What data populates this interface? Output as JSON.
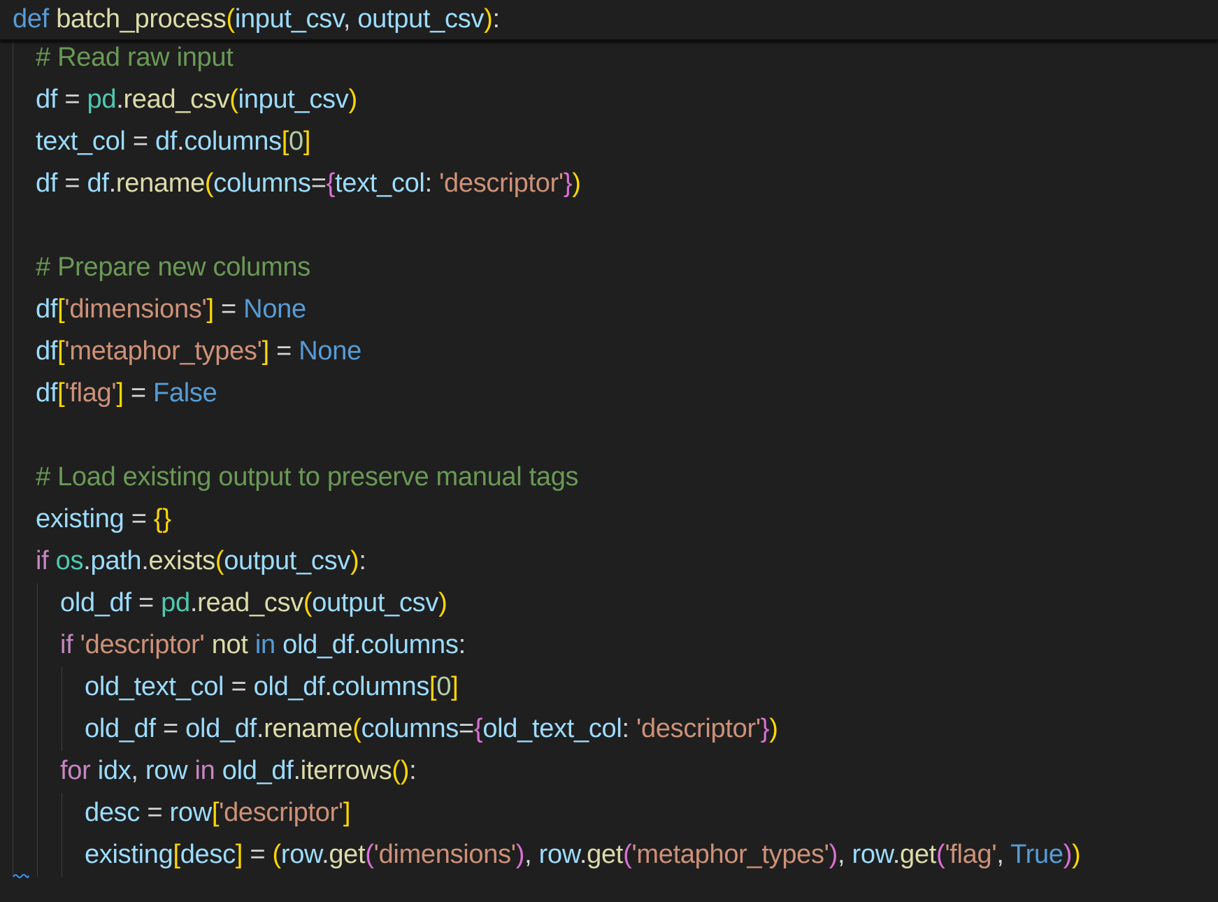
{
  "colors": {
    "background": "#1f1f1f",
    "keyword": "#569cd6",
    "control": "#c586c0",
    "function": "#dcdcaa",
    "variable": "#9cdcfe",
    "plain": "#d4d4d4",
    "string": "#ce9178",
    "comment": "#6a9955",
    "module": "#4ec9b0",
    "number": "#b5cea8",
    "bracket1": "#ffd700",
    "bracket2": "#da70d6",
    "bracket3": "#179fff",
    "squiggle": "#3794ff"
  },
  "editor": {
    "sticky_line": [
      [
        "def",
        "keyword"
      ],
      [
        " ",
        "plain"
      ],
      [
        "batch_process",
        "function"
      ],
      [
        "(",
        "bracket1"
      ],
      [
        "input_csv",
        "variable"
      ],
      [
        ", ",
        "plain"
      ],
      [
        "output_csv",
        "variable"
      ],
      [
        ")",
        "bracket1"
      ],
      [
        ":",
        "plain"
      ]
    ],
    "lines": [
      {
        "indent": 1,
        "tokens": [
          [
            "# Read raw input",
            "comment"
          ]
        ]
      },
      {
        "indent": 1,
        "tokens": [
          [
            "df",
            "variable"
          ],
          [
            " = ",
            "plain"
          ],
          [
            "pd",
            "module"
          ],
          [
            ".",
            "plain"
          ],
          [
            "read_csv",
            "function"
          ],
          [
            "(",
            "bracket1"
          ],
          [
            "input_csv",
            "variable"
          ],
          [
            ")",
            "bracket1"
          ]
        ]
      },
      {
        "indent": 1,
        "tokens": [
          [
            "text_col",
            "variable"
          ],
          [
            " = ",
            "plain"
          ],
          [
            "df",
            "variable"
          ],
          [
            ".",
            "plain"
          ],
          [
            "columns",
            "variable"
          ],
          [
            "[",
            "bracket1"
          ],
          [
            "0",
            "number"
          ],
          [
            "]",
            "bracket1"
          ]
        ]
      },
      {
        "indent": 1,
        "tokens": [
          [
            "df",
            "variable"
          ],
          [
            " = ",
            "plain"
          ],
          [
            "df",
            "variable"
          ],
          [
            ".",
            "plain"
          ],
          [
            "rename",
            "function"
          ],
          [
            "(",
            "bracket1"
          ],
          [
            "columns",
            "variable"
          ],
          [
            "=",
            "plain"
          ],
          [
            "{",
            "bracket2"
          ],
          [
            "text_col",
            "variable"
          ],
          [
            ": ",
            "plain"
          ],
          [
            "'descriptor'",
            "string"
          ],
          [
            "}",
            "bracket2"
          ],
          [
            ")",
            "bracket1"
          ]
        ]
      },
      {
        "indent": 1,
        "tokens": []
      },
      {
        "indent": 1,
        "tokens": [
          [
            "# Prepare new columns",
            "comment"
          ]
        ]
      },
      {
        "indent": 1,
        "tokens": [
          [
            "df",
            "variable"
          ],
          [
            "[",
            "bracket1"
          ],
          [
            "'dimensions'",
            "string"
          ],
          [
            "]",
            "bracket1"
          ],
          [
            " = ",
            "plain"
          ],
          [
            "None",
            "keyword"
          ]
        ]
      },
      {
        "indent": 1,
        "tokens": [
          [
            "df",
            "variable"
          ],
          [
            "[",
            "bracket1"
          ],
          [
            "'metaphor_types'",
            "string"
          ],
          [
            "]",
            "bracket1"
          ],
          [
            " = ",
            "plain"
          ],
          [
            "None",
            "keyword"
          ]
        ]
      },
      {
        "indent": 1,
        "tokens": [
          [
            "df",
            "variable"
          ],
          [
            "[",
            "bracket1"
          ],
          [
            "'flag'",
            "string"
          ],
          [
            "]",
            "bracket1"
          ],
          [
            " = ",
            "plain"
          ],
          [
            "False",
            "keyword"
          ]
        ]
      },
      {
        "indent": 1,
        "tokens": []
      },
      {
        "indent": 1,
        "tokens": [
          [
            "# Load existing output to preserve manual tags",
            "comment"
          ]
        ]
      },
      {
        "indent": 1,
        "tokens": [
          [
            "existing",
            "variable"
          ],
          [
            " = ",
            "plain"
          ],
          [
            "{}",
            "bracket1"
          ]
        ]
      },
      {
        "indent": 1,
        "tokens": [
          [
            "if",
            "control"
          ],
          [
            " ",
            "plain"
          ],
          [
            "os",
            "module"
          ],
          [
            ".",
            "plain"
          ],
          [
            "path",
            "variable"
          ],
          [
            ".",
            "plain"
          ],
          [
            "exists",
            "function"
          ],
          [
            "(",
            "bracket1"
          ],
          [
            "output_csv",
            "variable"
          ],
          [
            ")",
            "bracket1"
          ],
          [
            ":",
            "plain"
          ]
        ]
      },
      {
        "indent": 2,
        "tokens": [
          [
            "old_df",
            "variable"
          ],
          [
            " = ",
            "plain"
          ],
          [
            "pd",
            "module"
          ],
          [
            ".",
            "plain"
          ],
          [
            "read_csv",
            "function"
          ],
          [
            "(",
            "bracket1"
          ],
          [
            "output_csv",
            "variable"
          ],
          [
            ")",
            "bracket1"
          ]
        ]
      },
      {
        "indent": 2,
        "tokens": [
          [
            "if",
            "control"
          ],
          [
            " ",
            "plain"
          ],
          [
            "'descriptor'",
            "string"
          ],
          [
            " ",
            "plain"
          ],
          [
            "not",
            "function"
          ],
          [
            " ",
            "plain"
          ],
          [
            "in",
            "keyword"
          ],
          [
            " ",
            "plain"
          ],
          [
            "old_df",
            "variable"
          ],
          [
            ".",
            "plain"
          ],
          [
            "columns",
            "variable"
          ],
          [
            ":",
            "plain"
          ]
        ]
      },
      {
        "indent": 3,
        "tokens": [
          [
            "old_text_col",
            "variable"
          ],
          [
            " = ",
            "plain"
          ],
          [
            "old_df",
            "variable"
          ],
          [
            ".",
            "plain"
          ],
          [
            "columns",
            "variable"
          ],
          [
            "[",
            "bracket1"
          ],
          [
            "0",
            "number"
          ],
          [
            "]",
            "bracket1"
          ]
        ]
      },
      {
        "indent": 3,
        "tokens": [
          [
            "old_df",
            "variable"
          ],
          [
            " = ",
            "plain"
          ],
          [
            "old_df",
            "variable"
          ],
          [
            ".",
            "plain"
          ],
          [
            "rename",
            "function"
          ],
          [
            "(",
            "bracket1"
          ],
          [
            "columns",
            "variable"
          ],
          [
            "=",
            "plain"
          ],
          [
            "{",
            "bracket2"
          ],
          [
            "old_text_col",
            "variable"
          ],
          [
            ": ",
            "plain"
          ],
          [
            "'descriptor'",
            "string"
          ],
          [
            "}",
            "bracket2"
          ],
          [
            ")",
            "bracket1"
          ]
        ]
      },
      {
        "indent": 2,
        "tokens": [
          [
            "for",
            "control"
          ],
          [
            " ",
            "plain"
          ],
          [
            "idx",
            "variable"
          ],
          [
            ", ",
            "plain"
          ],
          [
            "row",
            "variable"
          ],
          [
            " ",
            "plain"
          ],
          [
            "in",
            "control"
          ],
          [
            " ",
            "plain"
          ],
          [
            "old_df",
            "variable"
          ],
          [
            ".",
            "plain"
          ],
          [
            "iterrows",
            "function"
          ],
          [
            "(",
            "bracket1"
          ],
          [
            ")",
            "bracket1"
          ],
          [
            ":",
            "plain"
          ]
        ]
      },
      {
        "indent": 3,
        "tokens": [
          [
            "desc",
            "variable"
          ],
          [
            " = ",
            "plain"
          ],
          [
            "row",
            "variable"
          ],
          [
            "[",
            "bracket1"
          ],
          [
            "'descriptor'",
            "string"
          ],
          [
            "]",
            "bracket1"
          ]
        ]
      },
      {
        "indent": 3,
        "tokens": [
          [
            "existing",
            "variable"
          ],
          [
            "[",
            "bracket1"
          ],
          [
            "desc",
            "variable"
          ],
          [
            "]",
            "bracket1"
          ],
          [
            " = ",
            "plain"
          ],
          [
            "(",
            "bracket1"
          ],
          [
            "row",
            "variable"
          ],
          [
            ".",
            "plain"
          ],
          [
            "get",
            "function"
          ],
          [
            "(",
            "bracket2"
          ],
          [
            "'dimensions'",
            "string"
          ],
          [
            ")",
            "bracket2"
          ],
          [
            ", ",
            "plain"
          ],
          [
            "row",
            "variable"
          ],
          [
            ".",
            "plain"
          ],
          [
            "get",
            "function"
          ],
          [
            "(",
            "bracket2"
          ],
          [
            "'metaphor_types'",
            "string"
          ],
          [
            ")",
            "bracket2"
          ],
          [
            ", ",
            "plain"
          ],
          [
            "row",
            "variable"
          ],
          [
            ".",
            "plain"
          ],
          [
            "get",
            "function"
          ],
          [
            "(",
            "bracket2"
          ],
          [
            "'flag'",
            "string"
          ],
          [
            ", ",
            "plain"
          ],
          [
            "True",
            "keyword"
          ],
          [
            ")",
            "bracket2"
          ],
          [
            ")",
            "bracket1"
          ]
        ]
      }
    ]
  }
}
